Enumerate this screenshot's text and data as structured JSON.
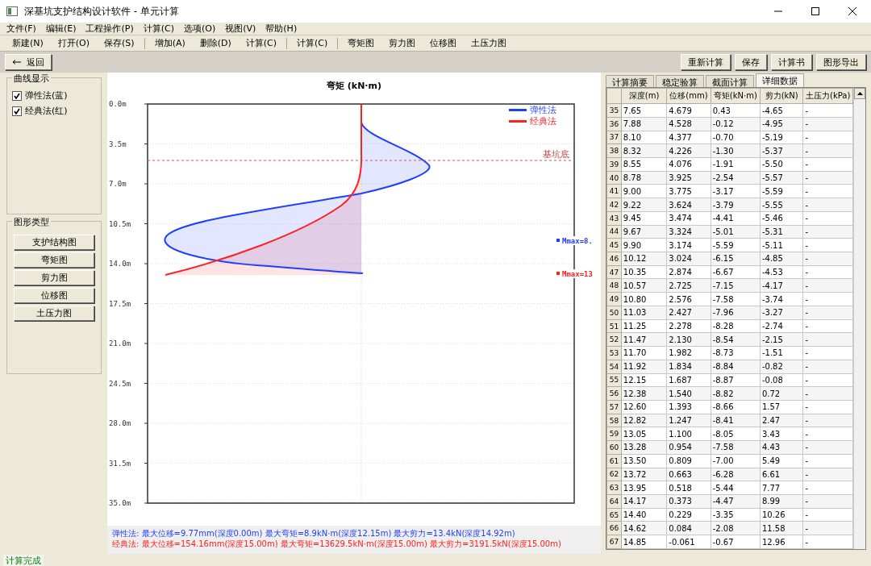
{
  "window": {
    "title": "深基坑支护结构设计软件 - 单元计算"
  },
  "menu": [
    "文件(F)",
    "编辑(E)",
    "工程操作(P)",
    "计算(C)",
    "选项(O)",
    "视图(V)",
    "帮助(H)"
  ],
  "toolbar_groups": [
    [
      "新建(N)",
      "打开(O)",
      "保存(S)"
    ],
    [
      "增加(A)",
      "删除(D)",
      "计算(C)"
    ],
    [
      "计算(C)"
    ],
    [
      "弯矩图",
      "剪力图",
      "位移图",
      "土压力图"
    ]
  ],
  "back_button": "返回",
  "action_buttons": [
    "重新计算",
    "保存",
    "计算书",
    "图形导出"
  ],
  "curve_panel": {
    "title": "曲线显示",
    "options": [
      {
        "label": "弹性法(蓝)",
        "checked": true
      },
      {
        "label": "经典法(红)",
        "checked": true
      }
    ]
  },
  "graph_panel": {
    "title": "图形类型",
    "buttons": [
      "支护结构图",
      "弯矩图",
      "剪力图",
      "位移图",
      "土压力图"
    ]
  },
  "chart": {
    "title": "弯矩 (kN·m)",
    "y_labels": [
      "0.0m",
      "3.5m",
      "7.0m",
      "10.5m",
      "14.0m",
      "17.5m",
      "21.0m",
      "24.5m",
      "28.0m",
      "31.5m",
      "35.0m"
    ],
    "legend": [
      {
        "label": "弹性法",
        "color": "#1f3fff"
      },
      {
        "label": "经典法",
        "color": "#ff2020"
      }
    ],
    "excavation_label": "基坑底",
    "max_labels": [
      {
        "text": "Mmax=8.",
        "color": "#1f3fff"
      },
      {
        "text": "Mmax=13",
        "color": "#ff2020"
      }
    ]
  },
  "summary_lines": [
    {
      "text": "弹性法: 最大位移=9.77mm(深度0.00m) 最大弯矩=8.9kN·m(深度12.15m) 最大剪力=13.4kN(深度14.92m)",
      "color": "#1f3fff"
    },
    {
      "text": "经典法: 最大位移=154.16mm(深度15.00m) 最大弯矩=13629.5kN·m(深度15.00m) 最大剪力=3191.5kN(深度15.00m)",
      "color": "#ff2020"
    }
  ],
  "tabs": [
    {
      "label": "计算摘要",
      "selected": false
    },
    {
      "label": "稳定验算",
      "selected": false
    },
    {
      "label": "截面计算",
      "selected": false
    },
    {
      "label": "详细数据",
      "selected": true
    }
  ],
  "table": {
    "columns": [
      "深度(m)",
      "位移(mm)",
      "弯矩(kN·m)",
      "剪力(kN)",
      "土压力(kPa)"
    ],
    "rows": [
      {
        "number": "35",
        "cells": [
          "7.65",
          "4.679",
          "0.43",
          "-4.65",
          "-"
        ]
      },
      {
        "number": "36",
        "cells": [
          "7.88",
          "4.528",
          "-0.12",
          "-4.95",
          "-"
        ]
      },
      {
        "number": "37",
        "cells": [
          "8.10",
          "4.377",
          "-0.70",
          "-5.19",
          "-"
        ]
      },
      {
        "number": "38",
        "cells": [
          "8.32",
          "4.226",
          "-1.30",
          "-5.37",
          "-"
        ]
      },
      {
        "number": "39",
        "cells": [
          "8.55",
          "4.076",
          "-1.91",
          "-5.50",
          "-"
        ]
      },
      {
        "number": "40",
        "cells": [
          "8.78",
          "3.925",
          "-2.54",
          "-5.57",
          "-"
        ]
      },
      {
        "number": "41",
        "cells": [
          "9.00",
          "3.775",
          "-3.17",
          "-5.59",
          "-"
        ]
      },
      {
        "number": "42",
        "cells": [
          "9.22",
          "3.624",
          "-3.79",
          "-5.55",
          "-"
        ]
      },
      {
        "number": "43",
        "cells": [
          "9.45",
          "3.474",
          "-4.41",
          "-5.46",
          "-"
        ]
      },
      {
        "number": "44",
        "cells": [
          "9.67",
          "3.324",
          "-5.01",
          "-5.31",
          "-"
        ]
      },
      {
        "number": "45",
        "cells": [
          "9.90",
          "3.174",
          "-5.59",
          "-5.11",
          "-"
        ]
      },
      {
        "number": "46",
        "cells": [
          "10.12",
          "3.024",
          "-6.15",
          "-4.85",
          "-"
        ]
      },
      {
        "number": "47",
        "cells": [
          "10.35",
          "2.874",
          "-6.67",
          "-4.53",
          "-"
        ]
      },
      {
        "number": "48",
        "cells": [
          "10.57",
          "2.725",
          "-7.15",
          "-4.17",
          "-"
        ]
      },
      {
        "number": "49",
        "cells": [
          "10.80",
          "2.576",
          "-7.58",
          "-3.74",
          "-"
        ]
      },
      {
        "number": "50",
        "cells": [
          "11.03",
          "2.427",
          "-7.96",
          "-3.27",
          "-"
        ]
      },
      {
        "number": "51",
        "cells": [
          "11.25",
          "2.278",
          "-8.28",
          "-2.74",
          "-"
        ]
      },
      {
        "number": "52",
        "cells": [
          "11.47",
          "2.130",
          "-8.54",
          "-2.15",
          "-"
        ]
      },
      {
        "number": "53",
        "cells": [
          "11.70",
          "1.982",
          "-8.73",
          "-1.51",
          "-"
        ]
      },
      {
        "number": "54",
        "cells": [
          "11.92",
          "1.834",
          "-8.84",
          "-0.82",
          "-"
        ]
      },
      {
        "number": "55",
        "cells": [
          "12.15",
          "1.687",
          "-8.87",
          "-0.08",
          "-"
        ]
      },
      {
        "number": "56",
        "cells": [
          "12.38",
          "1.540",
          "-8.82",
          "0.72",
          "-"
        ]
      },
      {
        "number": "57",
        "cells": [
          "12.60",
          "1.393",
          "-8.66",
          "1.57",
          "-"
        ]
      },
      {
        "number": "58",
        "cells": [
          "12.82",
          "1.247",
          "-8.41",
          "2.47",
          "-"
        ]
      },
      {
        "number": "59",
        "cells": [
          "13.05",
          "1.100",
          "-8.05",
          "3.43",
          "-"
        ]
      },
      {
        "number": "60",
        "cells": [
          "13.28",
          "0.954",
          "-7.58",
          "4.43",
          "-"
        ]
      },
      {
        "number": "61",
        "cells": [
          "13.50",
          "0.809",
          "-7.00",
          "5.49",
          "-"
        ]
      },
      {
        "number": "62",
        "cells": [
          "13.72",
          "0.663",
          "-6.28",
          "6.61",
          "-"
        ]
      },
      {
        "number": "63",
        "cells": [
          "13.95",
          "0.518",
          "-5.44",
          "7.77",
          "-"
        ]
      },
      {
        "number": "64",
        "cells": [
          "14.17",
          "0.373",
          "-4.47",
          "8.99",
          "-"
        ]
      },
      {
        "number": "65",
        "cells": [
          "14.40",
          "0.229",
          "-3.35",
          "10.26",
          "-"
        ]
      },
      {
        "number": "66",
        "cells": [
          "14.62",
          "0.084",
          "-2.08",
          "11.58",
          "-"
        ]
      },
      {
        "number": "67",
        "cells": [
          "14.85",
          "-0.061",
          "-0.67",
          "12.96",
          "-"
        ]
      }
    ]
  },
  "status_bar": "计算完成"
}
